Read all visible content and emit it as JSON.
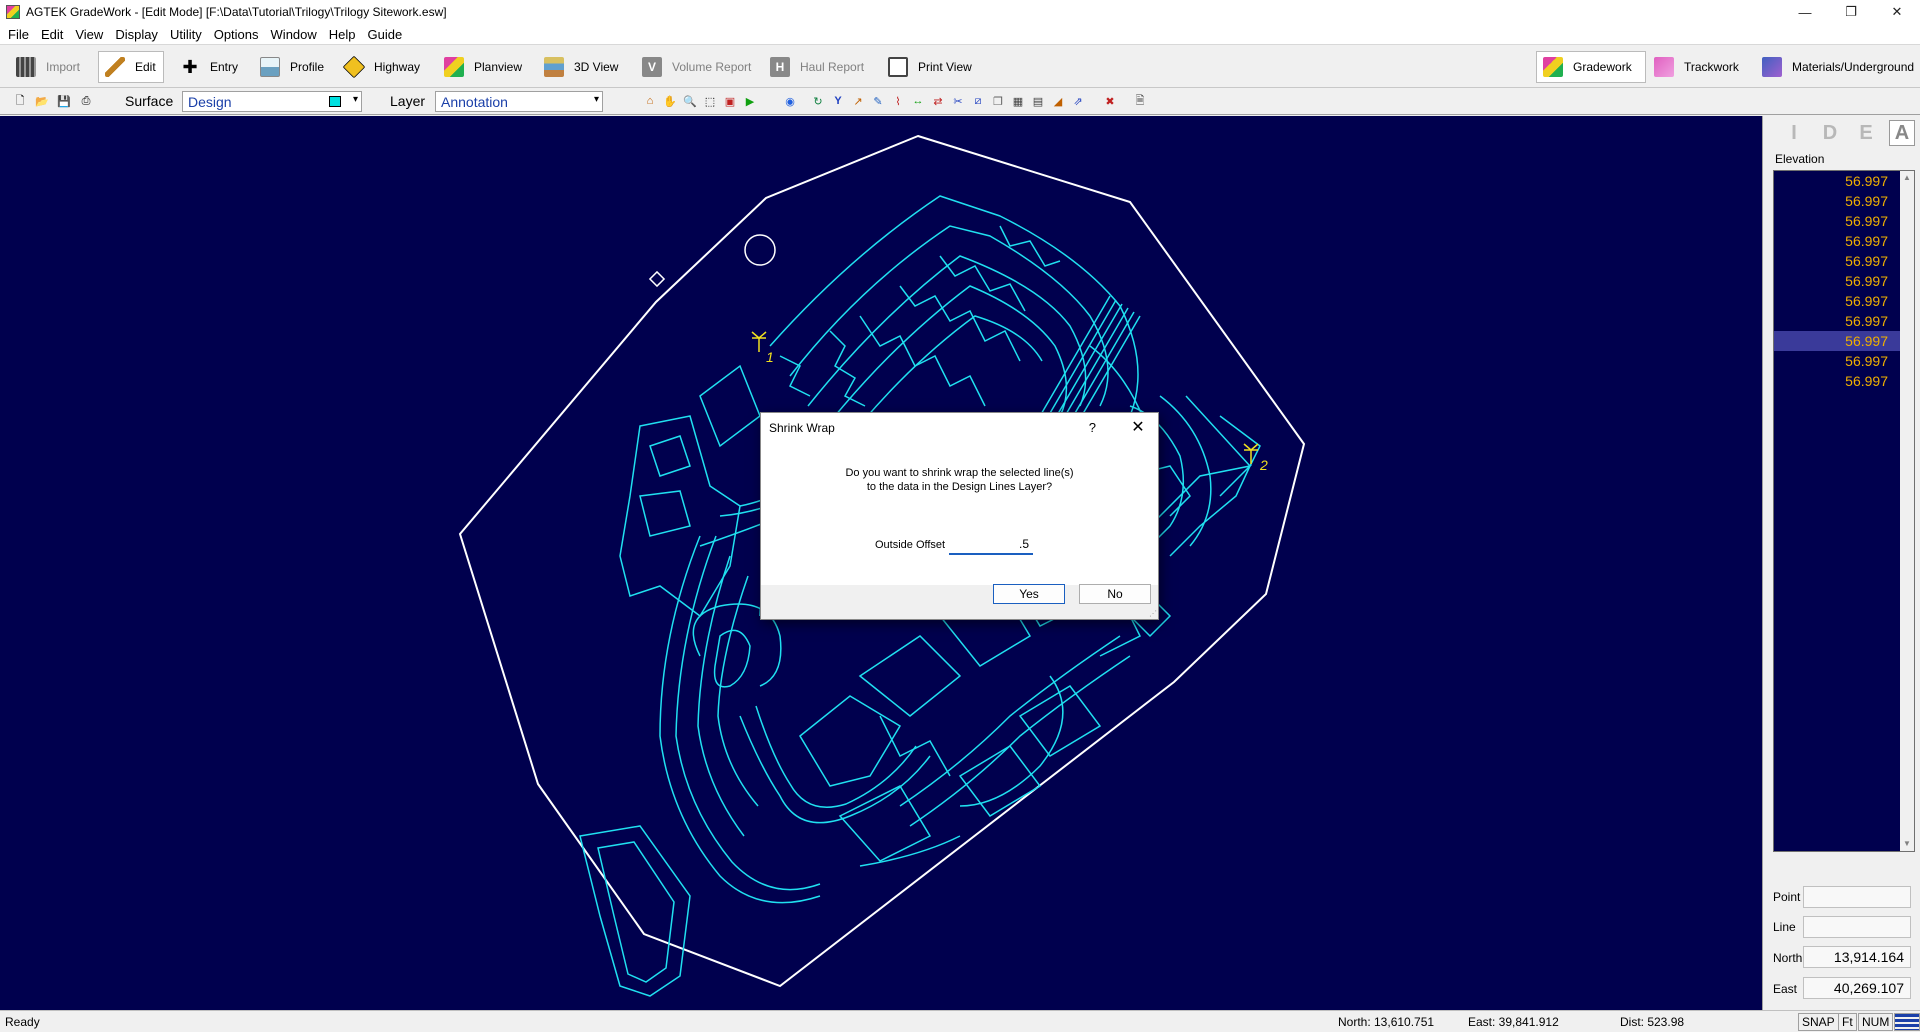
{
  "window": {
    "title": "AGTEK GradeWork - [Edit Mode]  [F:\\Data\\Tutorial\\Trilogy\\Trilogy Sitework.esw]"
  },
  "menu": [
    "File",
    "Edit",
    "View",
    "Display",
    "Utility",
    "Options",
    "Window",
    "Help",
    "Guide"
  ],
  "toolbar": {
    "import": "Import",
    "edit": "Edit",
    "entry": "Entry",
    "profile": "Profile",
    "highway": "Highway",
    "planview": "Planview",
    "view3d": "3D View",
    "volume_report": "Volume Report",
    "haul_report": "Haul Report",
    "print_view": "Print View",
    "gradework": "Gradework",
    "trackwork": "Trackwork",
    "materials": "Materials/Underground"
  },
  "subtoolbar": {
    "surface_label": "Surface",
    "surface_value": "Design",
    "layer_label": "Layer",
    "layer_value": "Annotation"
  },
  "canvas": {
    "marker1": "1",
    "marker2": "2"
  },
  "right_panel": {
    "tabs": [
      "I",
      "D",
      "E",
      "A"
    ],
    "elevation_label": "Elevation",
    "elevations": [
      "56.997",
      "56.997",
      "56.997",
      "56.997",
      "56.997",
      "56.997",
      "56.997",
      "56.997",
      "56.997",
      "56.997",
      "56.997"
    ],
    "selected_index": 8,
    "point_label": "Point",
    "point_value": "",
    "line_label": "Line",
    "line_value": "",
    "north_label": "North",
    "north_value": "13,914.164",
    "east_label": "East",
    "east_value": "40,269.107"
  },
  "status": {
    "ready": "Ready",
    "north": "North: 13,610.751",
    "east": "East: 39,841.912",
    "dist": "Dist: 523.98",
    "snap": "SNAP",
    "ft": "Ft",
    "num": "NUM"
  },
  "dialog": {
    "title": "Shrink Wrap",
    "help": "?",
    "message_line1": "Do you want to shrink wrap the selected line(s)",
    "message_line2": "to the data in the Design Lines Layer?",
    "offset_label": "Outside Offset",
    "offset_value": ".5",
    "yes": "Yes",
    "no": "No"
  },
  "colors": {
    "canvas_bg": "#00004e",
    "linework": "#20e0f0",
    "boundary": "#ffffff",
    "elevation_text": "#f0b000",
    "marker": "#f0e020"
  }
}
